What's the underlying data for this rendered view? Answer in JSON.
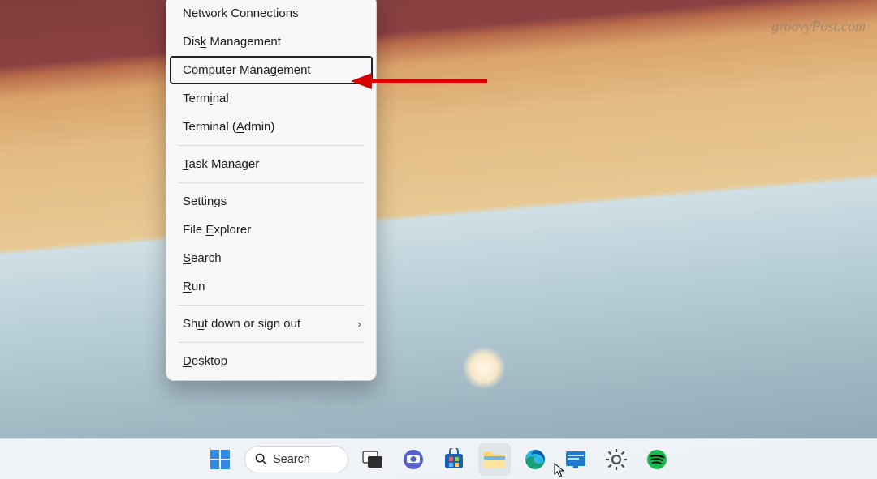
{
  "watermark": "groovyPost.com",
  "menu": {
    "items": [
      {
        "pre": "Net",
        "u": "w",
        "post": "ork Connections"
      },
      {
        "pre": "Dis",
        "u": "k",
        "post": " Management"
      },
      {
        "pre": "Computer Mana",
        "u": "g",
        "post": "ement",
        "highlight": true
      },
      {
        "pre": "Term",
        "u": "i",
        "post": "nal"
      },
      {
        "pre": "Terminal (",
        "u": "A",
        "post": "dmin)"
      },
      {
        "divider": true
      },
      {
        "pre": "",
        "u": "T",
        "post": "ask Manager"
      },
      {
        "divider": true
      },
      {
        "pre": "Setti",
        "u": "n",
        "post": "gs"
      },
      {
        "pre": "File ",
        "u": "E",
        "post": "xplorer"
      },
      {
        "pre": "",
        "u": "S",
        "post": "earch"
      },
      {
        "pre": "",
        "u": "R",
        "post": "un"
      },
      {
        "divider": true
      },
      {
        "pre": "Sh",
        "u": "u",
        "post": "t down or sign out",
        "submenu": true
      },
      {
        "divider": true
      },
      {
        "pre": "",
        "u": "D",
        "post": "esktop"
      }
    ]
  },
  "taskbar": {
    "search_label": "Search",
    "icons": [
      "start-icon",
      "search-pill",
      "task-view-icon",
      "chat-icon",
      "store-icon",
      "file-explorer-icon",
      "edge-icon",
      "widget-icon",
      "settings-icon",
      "spotify-icon"
    ]
  }
}
